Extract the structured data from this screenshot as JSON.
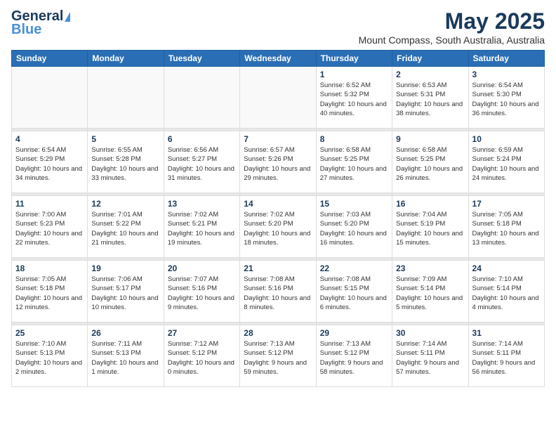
{
  "header": {
    "logo_general": "General",
    "logo_blue": "Blue",
    "month_year": "May 2025",
    "location": "Mount Compass, South Australia, Australia"
  },
  "weekdays": [
    "Sunday",
    "Monday",
    "Tuesday",
    "Wednesday",
    "Thursday",
    "Friday",
    "Saturday"
  ],
  "weeks": [
    [
      {
        "day": "",
        "empty": true
      },
      {
        "day": "",
        "empty": true
      },
      {
        "day": "",
        "empty": true
      },
      {
        "day": "",
        "empty": true
      },
      {
        "day": "1",
        "sunrise": "6:52 AM",
        "sunset": "5:32 PM",
        "daylight": "10 hours and 40 minutes."
      },
      {
        "day": "2",
        "sunrise": "6:53 AM",
        "sunset": "5:31 PM",
        "daylight": "10 hours and 38 minutes."
      },
      {
        "day": "3",
        "sunrise": "6:54 AM",
        "sunset": "5:30 PM",
        "daylight": "10 hours and 36 minutes."
      }
    ],
    [
      {
        "day": "4",
        "sunrise": "6:54 AM",
        "sunset": "5:29 PM",
        "daylight": "10 hours and 34 minutes."
      },
      {
        "day": "5",
        "sunrise": "6:55 AM",
        "sunset": "5:28 PM",
        "daylight": "10 hours and 33 minutes."
      },
      {
        "day": "6",
        "sunrise": "6:56 AM",
        "sunset": "5:27 PM",
        "daylight": "10 hours and 31 minutes."
      },
      {
        "day": "7",
        "sunrise": "6:57 AM",
        "sunset": "5:26 PM",
        "daylight": "10 hours and 29 minutes."
      },
      {
        "day": "8",
        "sunrise": "6:58 AM",
        "sunset": "5:25 PM",
        "daylight": "10 hours and 27 minutes."
      },
      {
        "day": "9",
        "sunrise": "6:58 AM",
        "sunset": "5:25 PM",
        "daylight": "10 hours and 26 minutes."
      },
      {
        "day": "10",
        "sunrise": "6:59 AM",
        "sunset": "5:24 PM",
        "daylight": "10 hours and 24 minutes."
      }
    ],
    [
      {
        "day": "11",
        "sunrise": "7:00 AM",
        "sunset": "5:23 PM",
        "daylight": "10 hours and 22 minutes."
      },
      {
        "day": "12",
        "sunrise": "7:01 AM",
        "sunset": "5:22 PM",
        "daylight": "10 hours and 21 minutes."
      },
      {
        "day": "13",
        "sunrise": "7:02 AM",
        "sunset": "5:21 PM",
        "daylight": "10 hours and 19 minutes."
      },
      {
        "day": "14",
        "sunrise": "7:02 AM",
        "sunset": "5:20 PM",
        "daylight": "10 hours and 18 minutes."
      },
      {
        "day": "15",
        "sunrise": "7:03 AM",
        "sunset": "5:20 PM",
        "daylight": "10 hours and 16 minutes."
      },
      {
        "day": "16",
        "sunrise": "7:04 AM",
        "sunset": "5:19 PM",
        "daylight": "10 hours and 15 minutes."
      },
      {
        "day": "17",
        "sunrise": "7:05 AM",
        "sunset": "5:18 PM",
        "daylight": "10 hours and 13 minutes."
      }
    ],
    [
      {
        "day": "18",
        "sunrise": "7:05 AM",
        "sunset": "5:18 PM",
        "daylight": "10 hours and 12 minutes."
      },
      {
        "day": "19",
        "sunrise": "7:06 AM",
        "sunset": "5:17 PM",
        "daylight": "10 hours and 10 minutes."
      },
      {
        "day": "20",
        "sunrise": "7:07 AM",
        "sunset": "5:16 PM",
        "daylight": "10 hours and 9 minutes."
      },
      {
        "day": "21",
        "sunrise": "7:08 AM",
        "sunset": "5:16 PM",
        "daylight": "10 hours and 8 minutes."
      },
      {
        "day": "22",
        "sunrise": "7:08 AM",
        "sunset": "5:15 PM",
        "daylight": "10 hours and 6 minutes."
      },
      {
        "day": "23",
        "sunrise": "7:09 AM",
        "sunset": "5:14 PM",
        "daylight": "10 hours and 5 minutes."
      },
      {
        "day": "24",
        "sunrise": "7:10 AM",
        "sunset": "5:14 PM",
        "daylight": "10 hours and 4 minutes."
      }
    ],
    [
      {
        "day": "25",
        "sunrise": "7:10 AM",
        "sunset": "5:13 PM",
        "daylight": "10 hours and 2 minutes."
      },
      {
        "day": "26",
        "sunrise": "7:11 AM",
        "sunset": "5:13 PM",
        "daylight": "10 hours and 1 minute."
      },
      {
        "day": "27",
        "sunrise": "7:12 AM",
        "sunset": "5:12 PM",
        "daylight": "10 hours and 0 minutes."
      },
      {
        "day": "28",
        "sunrise": "7:13 AM",
        "sunset": "5:12 PM",
        "daylight": "9 hours and 59 minutes."
      },
      {
        "day": "29",
        "sunrise": "7:13 AM",
        "sunset": "5:12 PM",
        "daylight": "9 hours and 58 minutes."
      },
      {
        "day": "30",
        "sunrise": "7:14 AM",
        "sunset": "5:11 PM",
        "daylight": "9 hours and 57 minutes."
      },
      {
        "day": "31",
        "sunrise": "7:14 AM",
        "sunset": "5:11 PM",
        "daylight": "9 hours and 56 minutes."
      }
    ]
  ],
  "labels": {
    "sunrise": "Sunrise:",
    "sunset": "Sunset:",
    "daylight": "Daylight:"
  }
}
